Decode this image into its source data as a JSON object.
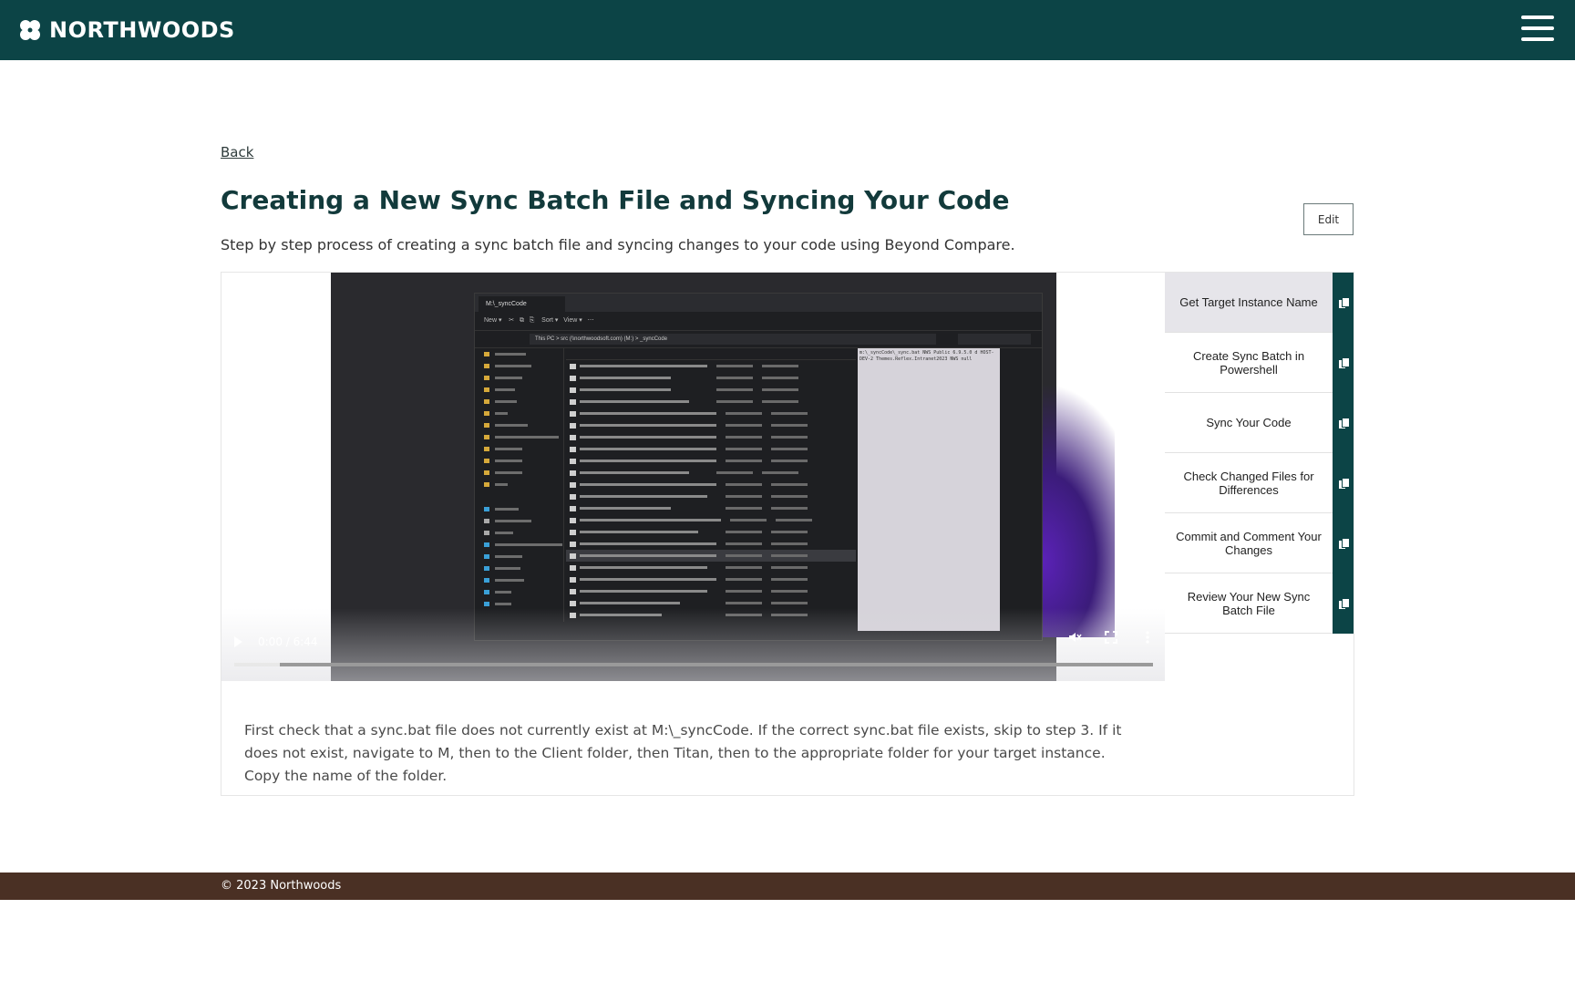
{
  "header": {
    "brand": "NORTHWOODS",
    "logo_icon": "flower-icon",
    "menu_icon": "hamburger-menu-icon"
  },
  "nav": {
    "back_label": "Back"
  },
  "page": {
    "title": "Creating a New Sync Batch File and Syncing Your Code",
    "subtitle": "Step by step process of creating a sync batch file and syncing changes to your code using Beyond Compare.",
    "edit_label": "Edit"
  },
  "video": {
    "time": "0:00 / 6:44",
    "progress_fraction": 0.05,
    "play_icon": "play-icon",
    "mute_icon": "mute-icon",
    "fullscreen_icon": "fullscreen-icon",
    "more_icon": "more-options-icon",
    "explorer_tab": "M:\\_syncCode",
    "explorer_address": "This PC  >  src (\\\\northwoodsoft.com) (M:)  >  _syncCode",
    "preview_text": "m:\\_syncCode\\_sync.bat NWS Public 6.9.5.0 d HOST-DEV-2 Themes.Reflex.Intranet2023 NWS null"
  },
  "steps": [
    {
      "label": "Get Target Instance Name",
      "icon": "copy-icon",
      "active": true
    },
    {
      "label": "Create Sync Batch in Powershell",
      "icon": "copy-icon",
      "active": false
    },
    {
      "label": "Sync Your Code",
      "icon": "copy-icon",
      "active": false
    },
    {
      "label": "Check Changed Files for Differences",
      "icon": "copy-icon",
      "active": false
    },
    {
      "label": "Commit and Comment Your Changes",
      "icon": "copy-icon",
      "active": false
    },
    {
      "label": "Review Your New Sync Batch File",
      "icon": "copy-icon",
      "active": false
    }
  ],
  "description": "First check that a sync.bat file does not currently exist at M:\\_syncCode. If the correct sync.bat file exists, skip to step 3. If it does not exist, navigate to M, then to the Client folder, then Titan, then to the appropriate folder for your target instance. Copy the name of the folder.",
  "footer": {
    "copyright": "© 2023 Northwoods"
  },
  "colors": {
    "header_bg": "#0c4446",
    "footer_bg": "#4a3024",
    "step_active_bg": "#e6e5ea"
  }
}
